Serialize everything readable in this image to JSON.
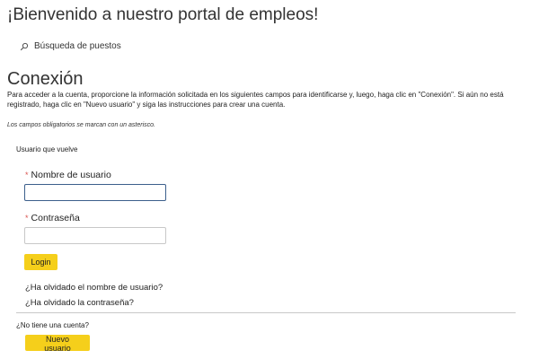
{
  "header": {
    "title": "¡Bienvenido a nuestro portal de empleos!"
  },
  "nav": {
    "search_label": "Búsqueda de puestos",
    "search_icon": "search-icon"
  },
  "login": {
    "title": "Conexión",
    "intro": "Para acceder a la cuenta, proporcione la información solicitada en los siguientes campos para identificarse y, luego, haga clic en \"Conexión\". Si aún no está registrado, haga clic en \"Nuevo usuario\" y siga las instrucciones para crear una cuenta.",
    "required_note": "Los campos obligatorios se marcan con un asterisco.",
    "returning_user_label": "Usuario que vuelve",
    "username": {
      "asterisk": "*",
      "label": "Nombre de usuario",
      "value": ""
    },
    "password": {
      "asterisk": "*",
      "label": "Contraseña",
      "value": ""
    },
    "login_button": "Login",
    "forgot_username": "¿Ha olvidado el nombre de usuario?",
    "forgot_password": "¿Ha olvidado la contraseña?"
  },
  "signup": {
    "prompt": "¿No tiene una cuenta?",
    "new_user_button": "Nuevo usuario"
  },
  "colors": {
    "button": "#f5cf1b",
    "asterisk": "#d9534f",
    "focus_border": "#3c5f8c",
    "divider": "#c8c8c8"
  }
}
